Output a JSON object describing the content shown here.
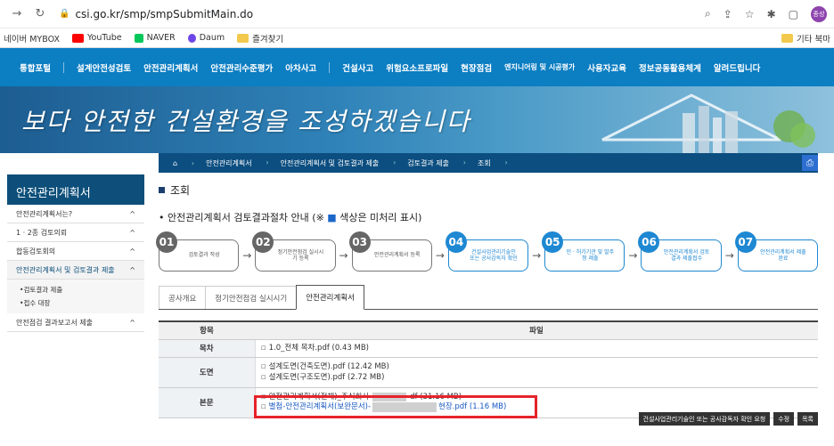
{
  "browser": {
    "url": "csi.go.kr/smp/smpSubmitMain.do",
    "profile": "종성",
    "bookmarks": [
      {
        "label": "네이버 MYBOX",
        "color": "#ffffff"
      },
      {
        "label": "YouTube",
        "color": "#ff0000"
      },
      {
        "label": "NAVER",
        "color": "#03c75a"
      },
      {
        "label": "Daum",
        "color": "#6e46e8"
      },
      {
        "label": "즐겨찾기",
        "color": "#f2c94c"
      }
    ],
    "other_bookmarks": "기타 북마"
  },
  "gnb": {
    "items": [
      "통합포털",
      "설계안전성검토",
      "안전관리계획서",
      "안전관리수준평가",
      "아차사고",
      "건설사고",
      "위험요소프로파일",
      "현장점검",
      "엔지니어링 및 시공평가",
      "사용자교육",
      "정보공동활용체계",
      "알려드립니다"
    ]
  },
  "banner": {
    "slogan": "보다 안전한 건설환경을 조성하겠습니다"
  },
  "breadcrumb": [
    "안전관리계획서",
    "안전관리계획서 및 검토결과 제출",
    "검토결과 제출",
    "조회"
  ],
  "sidebar": {
    "title": "안전관리계획서",
    "items": [
      {
        "label": "안전관리계획서는?",
        "sym": "^"
      },
      {
        "label": "1 · 2종 검토의뢰",
        "sym": "^"
      },
      {
        "label": "합동검토회의",
        "sym": "^"
      },
      {
        "label": "안전관리계획서 및 검토결과 제출",
        "sym": "^"
      }
    ],
    "subitems": [
      "검토결과 제출",
      "접수 대장"
    ],
    "last": {
      "label": "안전점검 결과보고서 제출",
      "sym": "^"
    }
  },
  "main": {
    "heading": "조회",
    "subtitle_pre": "안전관리계획서 검토결과절차 안내 (※ ",
    "subtitle_sq": "■",
    "subtitle_post": " 색상은 미처리 표시)",
    "steps": [
      {
        "num": "01",
        "label": "검토결과 작성"
      },
      {
        "num": "02",
        "label": "정기안전점검 실시시기 등록"
      },
      {
        "num": "03",
        "label": "안전관리계획서 등록"
      },
      {
        "num": "04",
        "label": "건설사업관리기술인 또는 공사감독자 확인"
      },
      {
        "num": "05",
        "label": "인 · 허가기관 및 발주청 제출"
      },
      {
        "num": "06",
        "label": "안전관리계획서 검토결과 제출접수"
      },
      {
        "num": "07",
        "label": "안전관리계획서 제출완료"
      }
    ],
    "tabs": [
      "공사개요",
      "정기안전점검 실시시기",
      "안전관리계획서"
    ],
    "table": {
      "headers": [
        "항목",
        "파일"
      ],
      "rows": [
        {
          "label": "목차",
          "files": [
            "1.0_전체 목차.pdf (0.43 MB)"
          ]
        },
        {
          "label": "도면",
          "files": [
            "설계도면(건축도면).pdf (12.42 MB)",
            "설계도면(구조도면).pdf (2.72 MB)"
          ]
        },
        {
          "label": "본문",
          "files": [
            "안전관리계획서(전체)_주식회사",
            "별첨-안전관리계획서(보완문서)-",
            "현장.pdf (1.16 MB)"
          ]
        }
      ]
    },
    "file_tail": "df (31.16 MB)",
    "buttons": [
      "건설사업관리기술인 또는 공사감독자 확인 요청",
      "수정",
      "목록"
    ]
  }
}
